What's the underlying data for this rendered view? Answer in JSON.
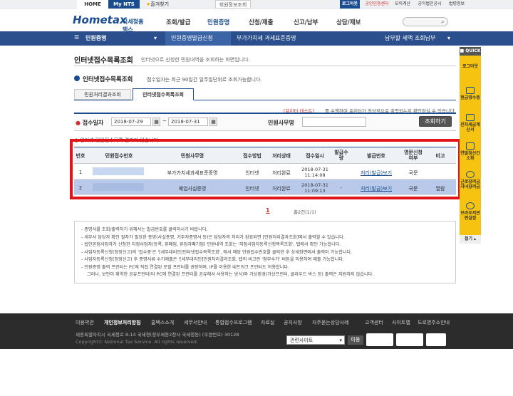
{
  "topbar": {
    "home": "HOME",
    "mynts": "My NTS",
    "bookmark": "즐겨찾기",
    "member": "회원정보조회",
    "logout": "로그아웃",
    "cert": "공인인증센터",
    "news": "모의계산",
    "notice": "공익법인공시",
    "law": "법령정보"
  },
  "header": {
    "logo_main": "Hometax",
    "logo_sub": "국세청홈택스",
    "menus": [
      "조회/발급",
      "민원증명",
      "신청/제출",
      "신고/납부",
      "상담/제보"
    ]
  },
  "nav": {
    "breadcrumb1": "민원증명",
    "breadcrumb2": "민원증명발급신청",
    "breadcrumb3": "부가가치세 과세표준증명",
    "right": "납부할 세액 조회납부"
  },
  "page": {
    "title": "인터넷접수목록조회",
    "title_desc": "인터넷으로 신청한 민원내역을 조회하는 화면입니다.",
    "sub_title": "인터넷접수목록조회",
    "sub_desc": "접수일자는 최근 90일간 일주일단위로 조회가능합니다.",
    "tab1": "민원처리결과조회",
    "tab2": "인터넷접수목록조회",
    "notice_red": "[프린터 테스트]",
    "notice_rest": "를 수행하여 프린터가 정상적으로 출력되는지 확인하실 수 있습니다.",
    "date_label": "접수일자",
    "date_from": "2018-07-29",
    "date_to": "2018-07-31",
    "name_label": "민원사무명",
    "search_btn": "조회하기",
    "result_label": "인터넷 민원접수목록 결과가 있습니다."
  },
  "table": {
    "headers": [
      "번호",
      "민원접수번호",
      "민원사무명",
      "접수방법",
      "처리상태",
      "접수일시",
      "발급수량",
      "발급번호",
      "영문신청여부",
      "비고"
    ],
    "rows": [
      [
        "1",
        "",
        "부가가치세과세표준증명",
        "인터넷",
        "처리완료",
        "2018-07-31 11:14:08",
        "",
        "처리(발급)보기",
        "국문",
        ""
      ],
      [
        "2",
        "",
        "폐업사실증명",
        "인터넷",
        "처리완료",
        "2018-07-31 11:09:13",
        "-",
        "처리(발급)보기",
        "국문",
        "열람"
      ]
    ]
  },
  "pagination": {
    "page": "1",
    "total": "총2건(1/1)"
  },
  "info": [
    "- 증명서를 조회/출력하기 위해서는 발급번호를 클릭하시기 바랍니다.",
    "- 세무서 담당자 확인 절차가 필요한 증명(사실증명, 거주자증명서 등)은 담당자의 처리가 완료되면 [민원처리결과조회]에서 출력할 수 있습니다.",
    "- 법인본점사업자가 신청한 지점사업자(등록, 휴폐업, 휴업자폐기업) 민원내역 조회는 '지점사업자등록신청목록조회', 탭에서 확인 가능합니다.",
    "- 사업자등록신청(정정신고)의 '접수중'은 '[세무대리인]인터넷접수목록조회', 에서 해당 민원접수번호를 클릭한 후 상세화면에서 출력이 가능합니다.",
    "- 사업자등록신청(정정신고) 후 증명서류 수기제출은 '[세무대리인]민원처리결과조회, 탭의 비고란 '첨부수기' 버튼을 이용하여 제출 가능합니다.",
    "- 민원증명 출력 프린터는 PC에 직접 연결된 로컬 프린터를 권장하며, IP를 이용한 네트워크 프린터도 허용합니다.",
    "그러나, 보안이 취약한 공유프린터(타 PC에 연결된 프린터를 공유해서 사용하는 방식)와 가상환경(가상프린터, 클라우드 박스 등) 출력은 지원하지 않습니다."
  ],
  "quick": {
    "title": "QUICK",
    "items": [
      "로그아웃",
      "현금영수증",
      "전자세금계산서",
      "연말정산간소화",
      "근로장려금자녀장려금",
      "브라우저관련설정",
      "접기"
    ]
  },
  "footer": {
    "links": [
      "이용약관",
      "개인정보처리방침",
      "홈택스소개",
      "세무서안내",
      "통합접수프로그램",
      "자료실",
      "공지사항",
      "자주묻는상담사례",
      "고객센터",
      "사이트맵",
      "도로명주소안내"
    ],
    "address": "세종특별자치시 국세청로 8-14 국세청(정부세종2청사 국세청동) (우편번호) 30128",
    "copyright": "Copyright© National Tax Service. All rights reserved.",
    "related": "관련사이트",
    "go": "이동"
  }
}
